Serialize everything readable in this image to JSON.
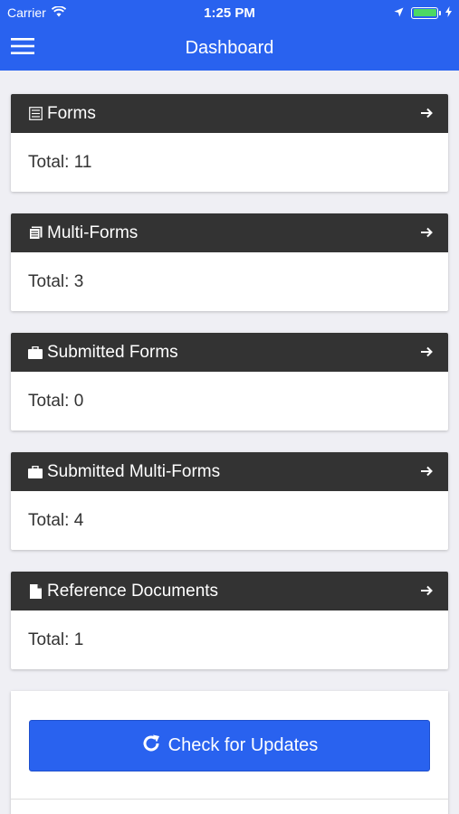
{
  "status_bar": {
    "carrier": "Carrier",
    "time": "1:25 PM",
    "battery_color": "#4cd964"
  },
  "nav": {
    "title": "Dashboard",
    "menu_icon": "hamburger-icon",
    "bg_color": "#2962ef"
  },
  "cards": [
    {
      "title": "Forms",
      "icon": "list-icon",
      "total": "Total: 11"
    },
    {
      "title": "Multi-Forms",
      "icon": "stacked-docs-icon",
      "total": "Total: 3"
    },
    {
      "title": "Submitted Forms",
      "icon": "briefcase-icon",
      "total": "Total: 0"
    },
    {
      "title": "Submitted Multi-Forms",
      "icon": "briefcase-icon",
      "total": "Total: 4"
    },
    {
      "title": "Reference Documents",
      "icon": "document-icon",
      "total": "Total: 1"
    }
  ],
  "update_button": {
    "label": "Check for Updates",
    "icon": "refresh-icon"
  }
}
